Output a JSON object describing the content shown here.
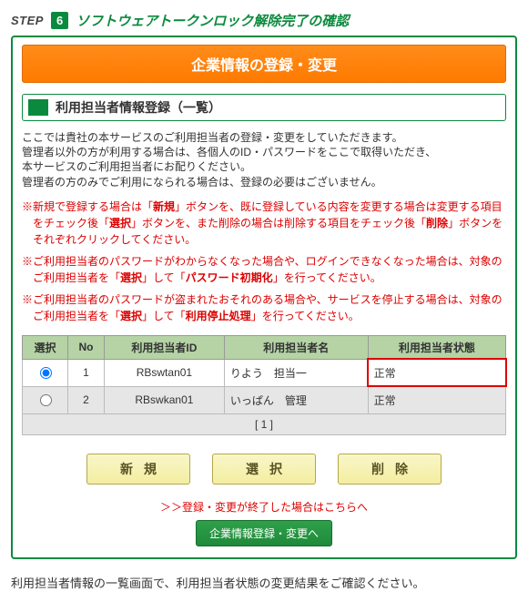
{
  "step": {
    "label": "STEP",
    "num": "6",
    "title": "ソフトウェアトークンロック解除完了の確認"
  },
  "orange_title": "企業情報の登録・変更",
  "sub_title": "利用担当者情報登録（一覧）",
  "intro": {
    "l1": "ここでは貴社の本サービスのご利用担当者の登録・変更をしていただきます。",
    "l2": "管理者以外の方が利用する場合は、各個人のID・パスワードをここで取得いただき、",
    "l3": "本サービスのご利用担当者にお配りください。",
    "l4": "管理者の方のみでご利用になられる場合は、登録の必要はございません。"
  },
  "notes": {
    "n1a": "※新規で登録する場合は「",
    "n1b": "新規",
    "n1c": "」ボタンを、既に登録している内容を変更する場合は変更する項目をチェック後「",
    "n1d": "選択",
    "n1e": "」ボタンを、また削除の場合は削除する項目をチェック後「",
    "n1f": "削除",
    "n1g": "」ボタンをそれぞれクリックしてください。",
    "n2a": "※ご利用担当者のパスワードがわからなくなった場合や、ログインできなくなった場合は、対象のご利用担当者を「",
    "n2b": "選択",
    "n2c": "」して「",
    "n2d": "パスワード初期化",
    "n2e": "」を行ってください。",
    "n3a": "※ご利用担当者のパスワードが盗まれたおそれのある場合や、サービスを停止する場合は、対象のご利用担当者を「",
    "n3b": "選択",
    "n3c": "」して「",
    "n3d": "利用停止処理",
    "n3e": "」を行ってください。"
  },
  "table": {
    "headers": {
      "sel": "選択",
      "no": "No",
      "id": "利用担当者ID",
      "name": "利用担当者名",
      "status": "利用担当者状態"
    },
    "rows": [
      {
        "no": "1",
        "id": "RBswtan01",
        "name": "りよう　担当一",
        "status": "正常",
        "selected": true,
        "highlight": true
      },
      {
        "no": "2",
        "id": "RBswkan01",
        "name": "いっぱん　管理",
        "status": "正常",
        "selected": false,
        "highlight": false
      }
    ],
    "pager": "[ 1 ]"
  },
  "buttons": {
    "new": "新規",
    "select": "選択",
    "delete": "削除"
  },
  "finish_link": "＞＞登録・変更が終了した場合はこちらへ",
  "finish_btn": "企業情報登録・変更へ",
  "footer": "利用担当者情報の一覧画面で、利用担当者状態の変更結果をご確認ください。"
}
